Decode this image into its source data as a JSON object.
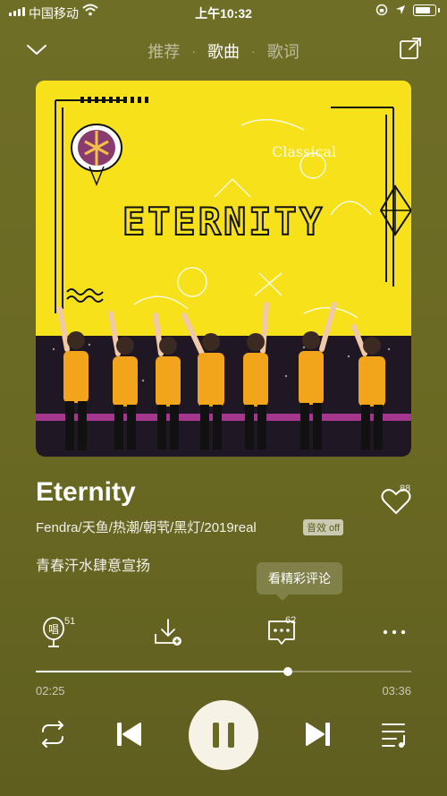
{
  "status_bar": {
    "carrier": "中国移动",
    "time": "上午10:32"
  },
  "nav": {
    "tabs": [
      {
        "label": "推荐",
        "active": false
      },
      {
        "label": "歌曲",
        "active": true
      },
      {
        "label": "歌词",
        "active": false
      }
    ],
    "separator": "·"
  },
  "cover": {
    "art_text": "ETERNITY"
  },
  "song": {
    "title": "Eternity",
    "artists": "Fendra/天鱼/热潮/朝茕/黑灯/2019real",
    "quality_badge": "音效 off",
    "subtitle": "青春汗水肆意宣扬",
    "like_count": "88"
  },
  "tooltip": {
    "text": "看精彩评论"
  },
  "actions": {
    "sing_label": "唱",
    "sing_count": "51",
    "comment_count": "62"
  },
  "player": {
    "current_time": "02:25",
    "duration": "03:36",
    "progress": 0.671
  },
  "colors": {
    "background": "#6b6a24",
    "cover_yellow": "#f6e11a",
    "pause_button": "#f6f3e6"
  },
  "icons": [
    "wifi-icon",
    "location-icon",
    "lock-rotation-icon",
    "battery-icon",
    "chevron-down-icon",
    "share-icon",
    "heart-icon",
    "microphone-icon",
    "download-icon",
    "comment-icon",
    "more-icon",
    "repeat-icon",
    "previous-icon",
    "pause-icon",
    "next-icon",
    "playlist-icon"
  ]
}
